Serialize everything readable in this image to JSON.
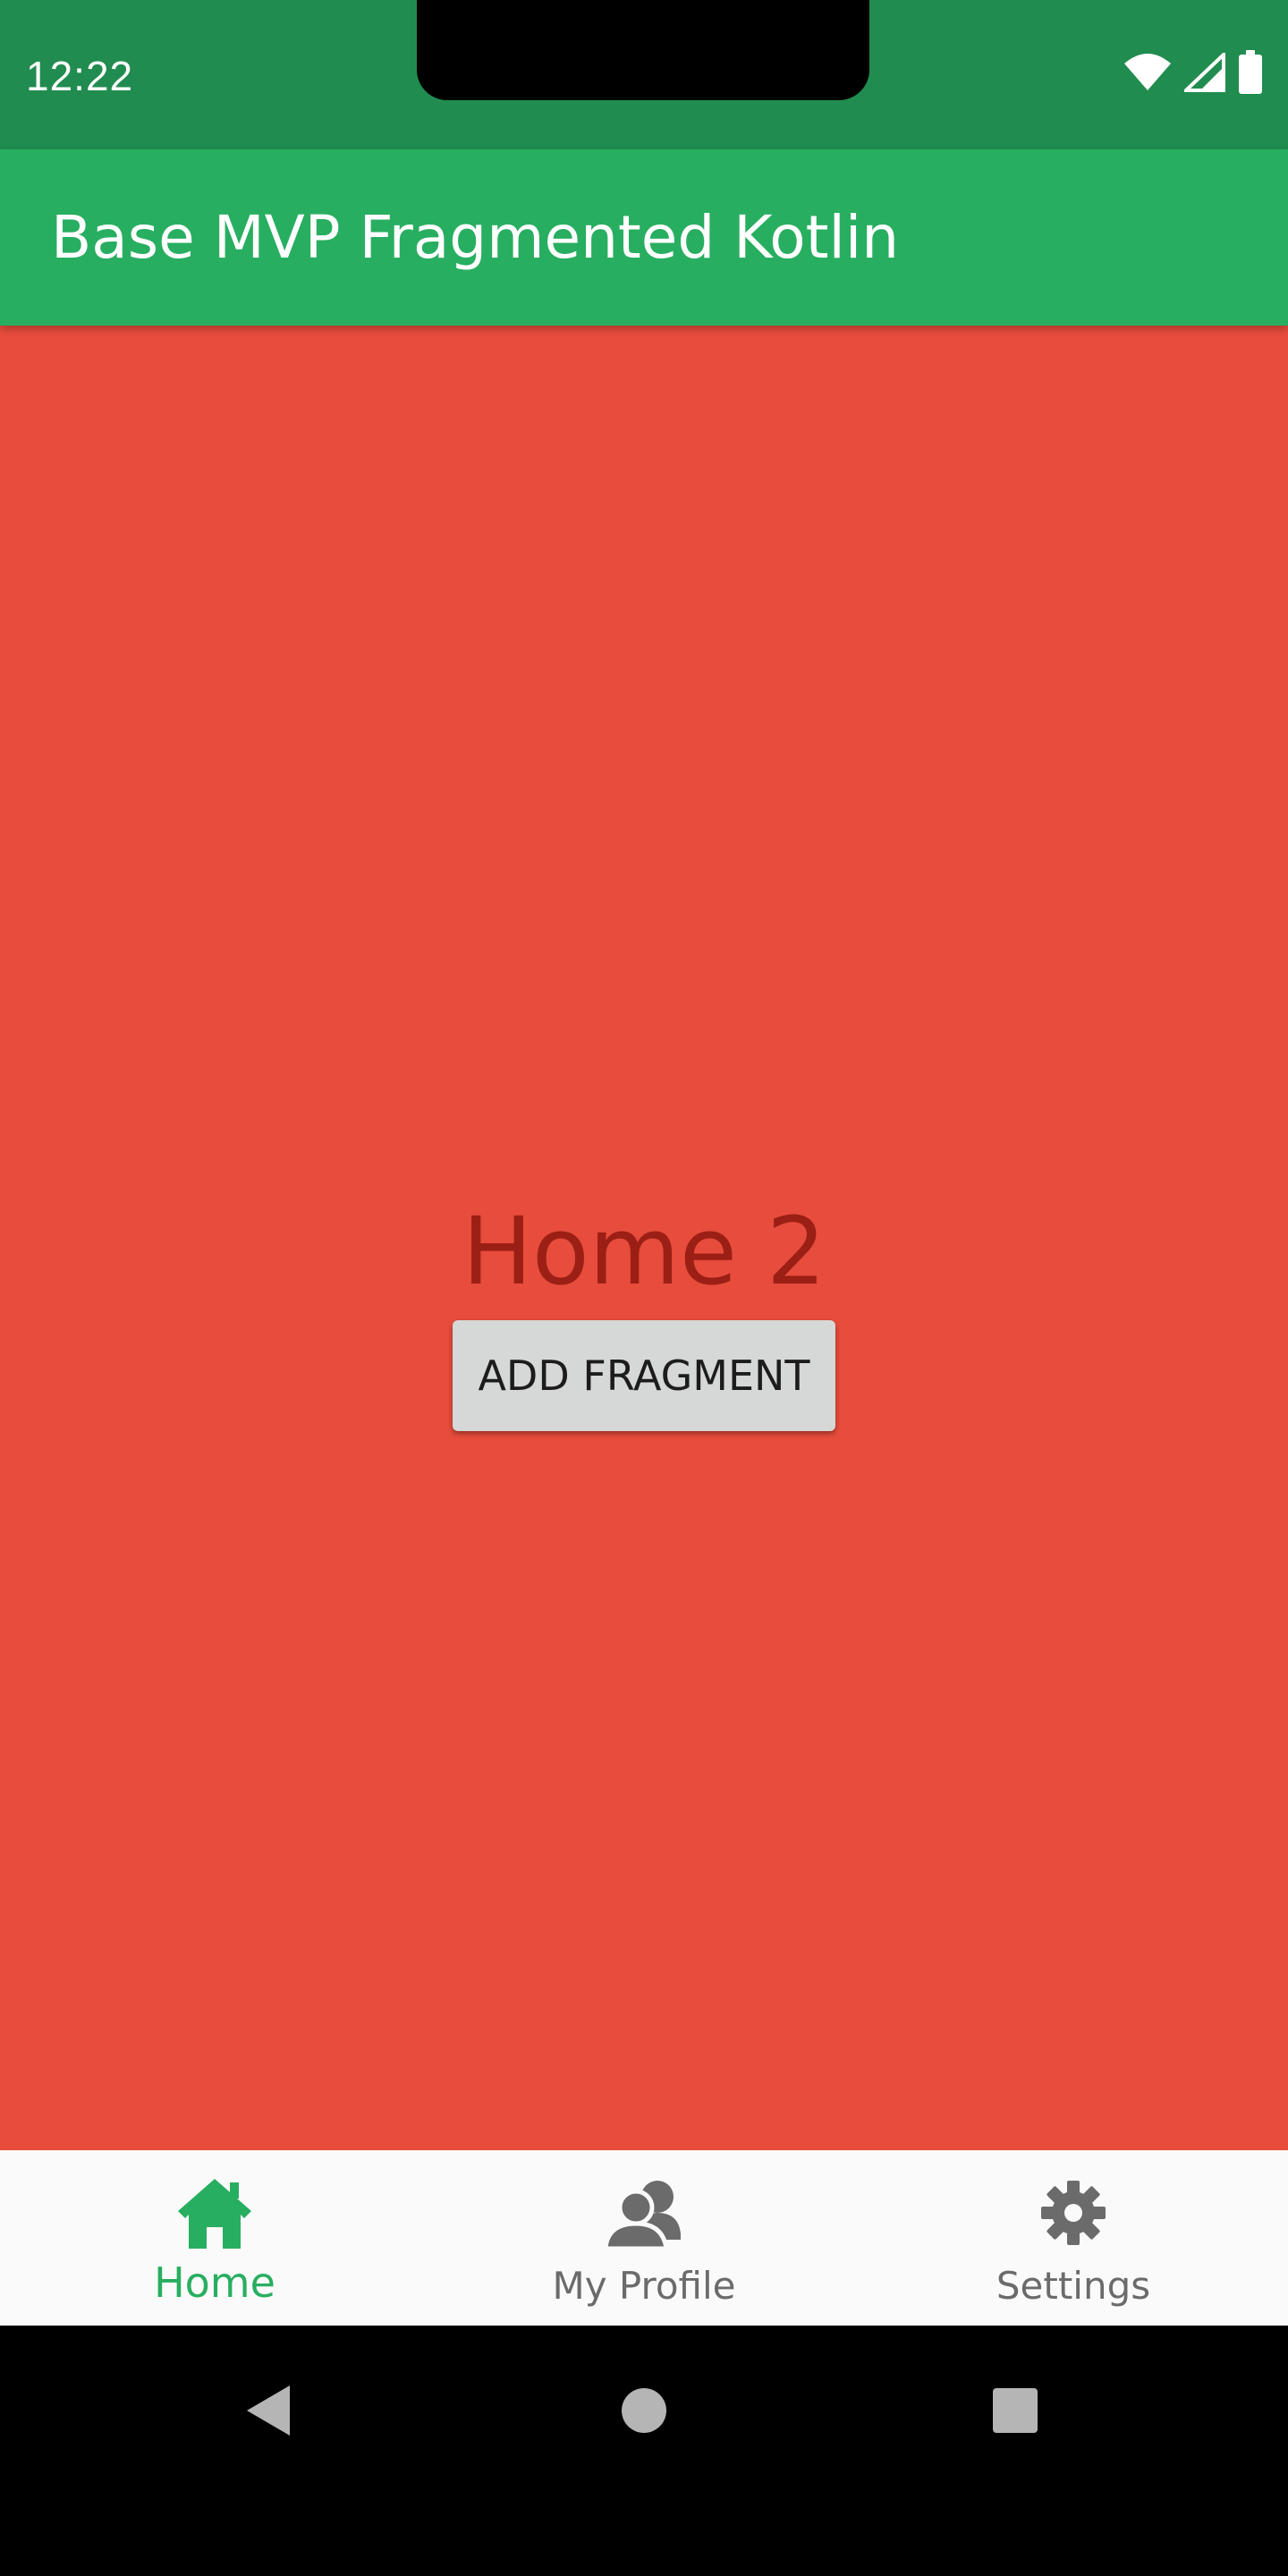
{
  "status_bar": {
    "time": "12:22",
    "icons": [
      "wifi-icon",
      "cell-signal-icon",
      "battery-icon"
    ]
  },
  "app_bar": {
    "title": "Base MVP Fragmented Kotlin"
  },
  "content": {
    "heading": "Home 2",
    "button_label": "ADD FRAGMENT"
  },
  "bottom_nav": {
    "items": [
      {
        "label": "Home",
        "icon": "home-icon",
        "active": true
      },
      {
        "label": "My Profile",
        "icon": "profile-icon",
        "active": false
      },
      {
        "label": "Settings",
        "icon": "gear-icon",
        "active": false
      }
    ]
  },
  "system_nav": {
    "buttons": [
      "back-icon",
      "home-circle-icon",
      "recents-icon"
    ]
  },
  "colors": {
    "status_bar": "#218C4F",
    "app_bar": "#28AE60",
    "content_bg": "#E74C3C",
    "heading_text": "#9B1F14",
    "button_bg": "#D6D7D7",
    "nav_active": "#28AE60",
    "nav_inactive": "#6B6B6B"
  }
}
